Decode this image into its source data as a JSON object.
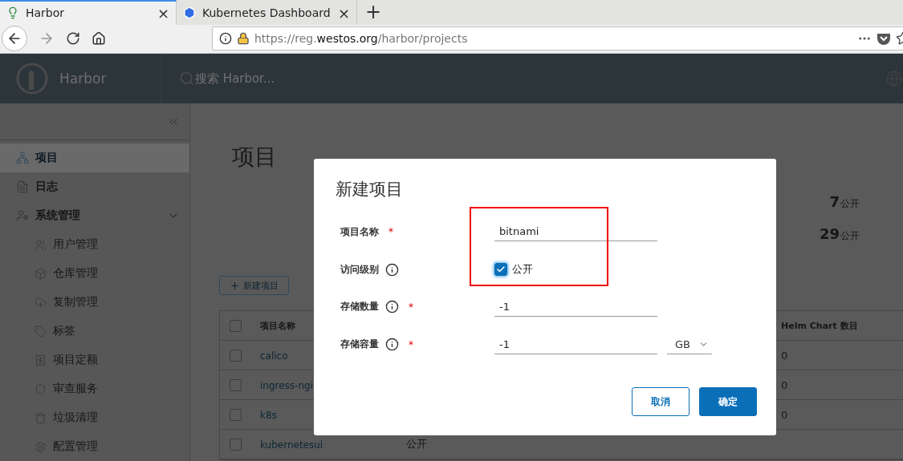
{
  "browser": {
    "tabs": [
      {
        "title": "Harbor",
        "selected": true,
        "close": "×"
      },
      {
        "title": "Kubernetes Dashboard",
        "selected": false,
        "close": "×"
      }
    ],
    "new_tab": "+",
    "url": {
      "prefix": "https://reg.",
      "domain": "westos.org",
      "path": "/harbor/projects"
    }
  },
  "header": {
    "brand": "Harbor",
    "search_placeholder": "搜索 Harbor..."
  },
  "sidebar": {
    "items": [
      {
        "label": "项目",
        "selected": true
      },
      {
        "label": "日志",
        "selected": false
      },
      {
        "label": "系统管理",
        "selected": false,
        "expanded": true,
        "children": [
          {
            "label": "用户管理",
            "selected": false
          },
          {
            "label": "仓库管理",
            "selected": false
          },
          {
            "label": "复制管理",
            "selected": false
          },
          {
            "label": "标签",
            "selected": false
          },
          {
            "label": "项目定额",
            "selected": false
          },
          {
            "label": "审查服务",
            "selected": false
          },
          {
            "label": "垃圾清理",
            "selected": false
          },
          {
            "label": "配置管理",
            "selected": false
          }
        ]
      }
    ]
  },
  "page": {
    "title": "项目",
    "stats": [
      {
        "value": "7",
        "unit": "公开"
      },
      {
        "value": "29",
        "unit": "公开"
      }
    ],
    "new_button": "新建项目",
    "table": {
      "select_all_checked": false,
      "columns": [
        "项目名称",
        "Helm Chart 数目"
      ],
      "rows": [
        {
          "checked": false,
          "name": "calico",
          "helm": "0"
        },
        {
          "checked": false,
          "name": "ingress-ngi",
          "helm": "0"
        },
        {
          "checked": false,
          "name": "k8s",
          "helm": "0"
        },
        {
          "checked": false,
          "name": "kubernetesui",
          "access": "公开"
        }
      ]
    }
  },
  "modal": {
    "title": "新建项目",
    "fields": [
      {
        "kind": "text",
        "label": "项目名称",
        "info": false,
        "required_mark": "*",
        "value": "bitnami"
      },
      {
        "kind": "checkbox",
        "label": "访问级别",
        "info": true,
        "checked": true,
        "option": "公开"
      },
      {
        "kind": "text",
        "label": "存储数量",
        "info": true,
        "required_mark": "*",
        "value": "-1"
      },
      {
        "kind": "unit",
        "label": "存储容量",
        "info": true,
        "required_mark": "*",
        "value": "-1",
        "unit": "GB"
      }
    ],
    "buttons": [
      {
        "label": "取消",
        "primary": false
      },
      {
        "label": "确定",
        "primary": true
      }
    ]
  }
}
